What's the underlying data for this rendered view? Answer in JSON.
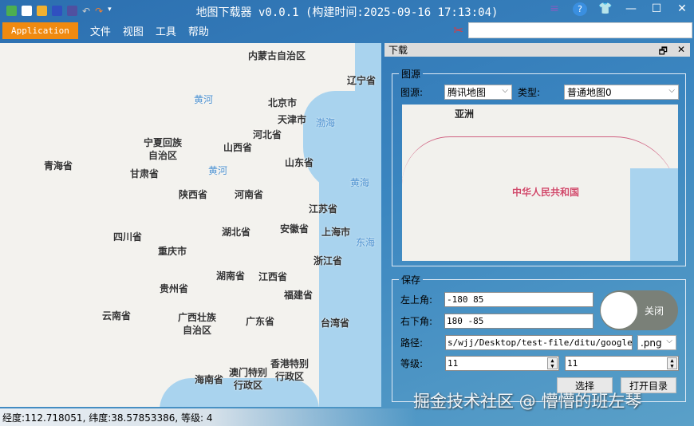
{
  "titlebar": {
    "title": "地图下载器 v0.0.1 (构建时间:2025-09-16 17:13:04)"
  },
  "menu": {
    "app": "Application",
    "items": [
      "文件",
      "视图",
      "工具",
      "帮助"
    ],
    "search_value": ""
  },
  "map": {
    "labels": [
      "内蒙古自治区",
      "辽宁省",
      "黄河",
      "北京市",
      "天津市",
      "渤海",
      "河北省",
      "宁夏回族\n自治区",
      "山西省",
      "山东省",
      "青海省",
      "甘肃省",
      "黄河",
      "黄海",
      "陕西省",
      "河南省",
      "江苏省",
      "四川省",
      "湖北省",
      "安徽省",
      "上海市",
      "东海",
      "重庆市",
      "浙江省",
      "贵州省",
      "湖南省",
      "江西省",
      "福建省",
      "云南省",
      "广西壮族\n自治区",
      "广东省",
      "台湾省",
      "海南省",
      "澳门特别\n行政区",
      "香港特别\n行政区"
    ]
  },
  "panel": {
    "title": "下载",
    "source_group": "图源",
    "source_label": "图源:",
    "source_value": "腾讯地图",
    "type_label": "类型:",
    "type_value": "普通地图0",
    "preview_labels": [
      "亚洲",
      "中华人民共和国"
    ],
    "save_group": "保存",
    "top_left_label": "左上角:",
    "top_left_value": "-180 85",
    "bottom_right_label": "右下角:",
    "bottom_right_value": "180 -85",
    "path_label": "路径:",
    "path_value": "s/wjj/Desktop/test-file/ditu/googlemap",
    "format_value": ".png",
    "level_label": "等级:",
    "level_min": "11",
    "level_max": "11",
    "toggle_label": "关闭",
    "toggle_on": false,
    "select_button": "选择",
    "open_dir_button": "打开目录"
  },
  "watermark": "掘金技术社区 @ 懵懵的班左琴",
  "status": "经度:112.718051, 纬度:38.57853386, 等级: 4"
}
